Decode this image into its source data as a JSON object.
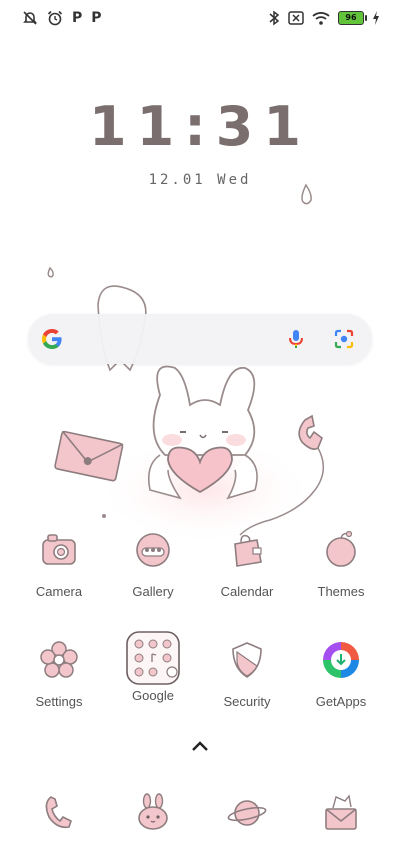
{
  "status_bar": {
    "left_icons": [
      "notifications-off-icon",
      "alarm-icon",
      "p-icon",
      "p-icon"
    ],
    "right_icons": [
      "bluetooth-icon",
      "sim-off-icon",
      "wifi-icon",
      "battery-icon",
      "charging-icon"
    ],
    "battery_level": "96",
    "accent": "#61c43a"
  },
  "clock": {
    "time": "11:31",
    "date": "12.01 Wed"
  },
  "search_bar": {
    "icons": [
      "google-logo",
      "mic-icon",
      "lens-icon"
    ]
  },
  "apps": [
    {
      "label": "Camera",
      "icon": "camera-icon"
    },
    {
      "label": "Gallery",
      "icon": "gallery-icon"
    },
    {
      "label": "Calendar",
      "icon": "calendar-icon"
    },
    {
      "label": "Themes",
      "icon": "themes-icon"
    },
    {
      "label": "Settings",
      "icon": "settings-flower-icon"
    },
    {
      "label": "Google",
      "icon": "google-folder-icon"
    },
    {
      "label": "Security",
      "icon": "security-shield-icon"
    },
    {
      "label": "GetApps",
      "icon": "getapps-icon"
    }
  ],
  "dock": [
    {
      "icon": "phone-icon"
    },
    {
      "icon": "messages-bunny-icon"
    },
    {
      "icon": "browser-planet-icon"
    },
    {
      "icon": "mail-envelope-icon"
    }
  ],
  "colors": {
    "pink": "#f3c6cc",
    "outline": "#8e7d7f"
  }
}
